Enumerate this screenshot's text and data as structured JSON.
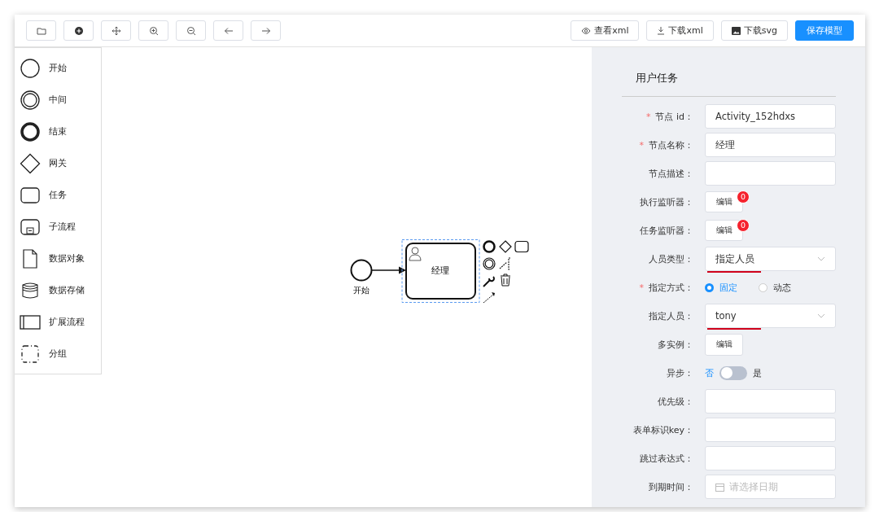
{
  "toolbar": {
    "text_buttons": [
      {
        "kind": "view",
        "label": "查看xml"
      },
      {
        "kind": "download",
        "label": "下载xml"
      },
      {
        "kind": "image",
        "label": "下载svg"
      },
      {
        "kind": "primary",
        "label": "保存模型"
      }
    ]
  },
  "palette": [
    {
      "kind": "start",
      "label": "开始"
    },
    {
      "kind": "intermediate",
      "label": "中间"
    },
    {
      "kind": "end",
      "label": "结束"
    },
    {
      "kind": "gateway",
      "label": "网关"
    },
    {
      "kind": "task",
      "label": "任务"
    },
    {
      "kind": "subprocess",
      "label": "子流程"
    },
    {
      "kind": "data-object",
      "label": "数据对象"
    },
    {
      "kind": "data-store",
      "label": "数据存储"
    },
    {
      "kind": "pool",
      "label": "扩展流程"
    },
    {
      "kind": "group",
      "label": "分组"
    }
  ],
  "diagram": {
    "start_label": "开始",
    "task_label": "经理",
    "task_selected": true
  },
  "panel": {
    "title": "用户任务",
    "fields": [
      {
        "kind": "input",
        "required_mark": "*",
        "label": "节点 id：",
        "value": "Activity_152hdxs"
      },
      {
        "kind": "input",
        "required_mark": "*",
        "label": "节点名称：",
        "value": "经理"
      },
      {
        "kind": "input",
        "label": "节点描述："
      },
      {
        "kind": "listener",
        "label": "执行监听器：",
        "button": "编辑",
        "count": "0"
      },
      {
        "kind": "listener",
        "label": "任务监听器：",
        "button": "编辑",
        "count": "0"
      },
      {
        "kind": "select",
        "label": "人员类型：",
        "value": "指定人员",
        "underlined": true
      },
      {
        "kind": "radio",
        "required_mark": "*",
        "label": "指定方式：",
        "options": [
          {
            "label": "固定",
            "selected": true
          },
          {
            "label": "动态",
            "selected": false
          }
        ]
      },
      {
        "kind": "select",
        "label": "指定人员：",
        "value": "tony",
        "underlined": true
      },
      {
        "kind": "button",
        "label": "多实例：",
        "button": "编辑"
      },
      {
        "kind": "switch",
        "label": "异步：",
        "off_label": "否",
        "on_label": "是",
        "on": false
      },
      {
        "kind": "input",
        "label": "优先级："
      },
      {
        "kind": "input",
        "label": "表单标识key："
      },
      {
        "kind": "input",
        "label": "跳过表达式："
      },
      {
        "kind": "date",
        "label": "到期时间：",
        "placeholder": "请选择日期"
      }
    ]
  }
}
